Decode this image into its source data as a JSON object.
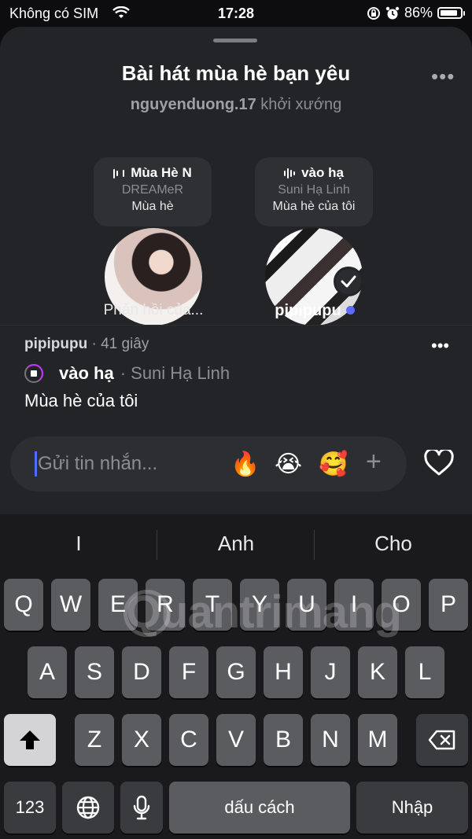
{
  "status": {
    "carrier": "Không có SIM",
    "time": "17:28",
    "battery": "86%",
    "battery_level": 0.86
  },
  "sheet": {
    "title": "Bài hát mùa hè bạn yêu",
    "more": "•••",
    "starter_user": "nguyenduong.17",
    "starter_suffix": "khởi xướng"
  },
  "responses": [
    {
      "song": "Mùa Hè N",
      "artist": "DREAMeR",
      "note": "Mùa hè",
      "label": "Phản hồi của..."
    },
    {
      "song": "vào hạ",
      "artist": "Suni Hạ Linh",
      "note": "Mùa hè của tôi",
      "label": "pipipupu"
    }
  ],
  "selected": {
    "user": "pipipupu",
    "time": "· 41 giây",
    "song": "vào hạ",
    "artist": "· Suni Hạ Linh",
    "message": "Mùa hè của tôi",
    "more": "•••"
  },
  "composer": {
    "placeholder": "Gửi tin nhắn...",
    "emojis": [
      "🔥",
      "😭",
      "🥰"
    ],
    "add": "+"
  },
  "keyboard": {
    "suggestions": [
      "I",
      "Anh",
      "Cho"
    ],
    "row1": [
      "Q",
      "W",
      "E",
      "R",
      "T",
      "Y",
      "U",
      "I",
      "O",
      "P"
    ],
    "row2": [
      "A",
      "S",
      "D",
      "F",
      "G",
      "H",
      "J",
      "K",
      "L"
    ],
    "row3": [
      "Z",
      "X",
      "C",
      "V",
      "B",
      "N",
      "M"
    ],
    "numbers": "123",
    "space": "dấu cách",
    "return": "Nhập"
  },
  "watermark": "uantrimang"
}
